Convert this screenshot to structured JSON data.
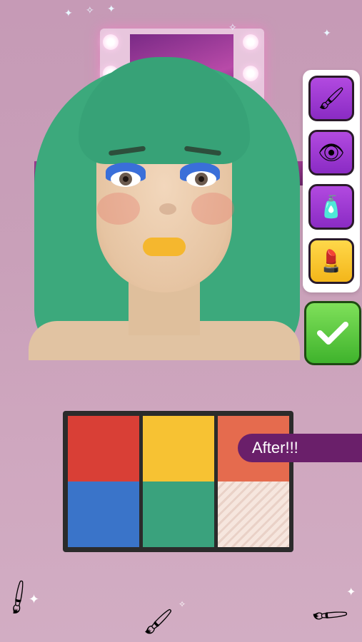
{
  "status_banner": {
    "text": "After!!!"
  },
  "tools": [
    {
      "name": "foundation-brush",
      "icon": "🖌",
      "active": true
    },
    {
      "name": "eyeshadow",
      "icon": "👁",
      "active": false
    },
    {
      "name": "blush-compact",
      "icon": "🧴",
      "active": false
    },
    {
      "name": "lipstick",
      "icon": "💄",
      "active": false
    }
  ],
  "confirm_button": {
    "label": "✓"
  },
  "palette": {
    "colors": [
      "#d93f36",
      "#f7c233",
      "#e56b4e",
      "#3a74c9",
      "#3aa27d",
      "#f3e1d8"
    ]
  },
  "bottom_tools": [
    "hair-dye-brush",
    "makeup-brush",
    "powder-brush"
  ]
}
